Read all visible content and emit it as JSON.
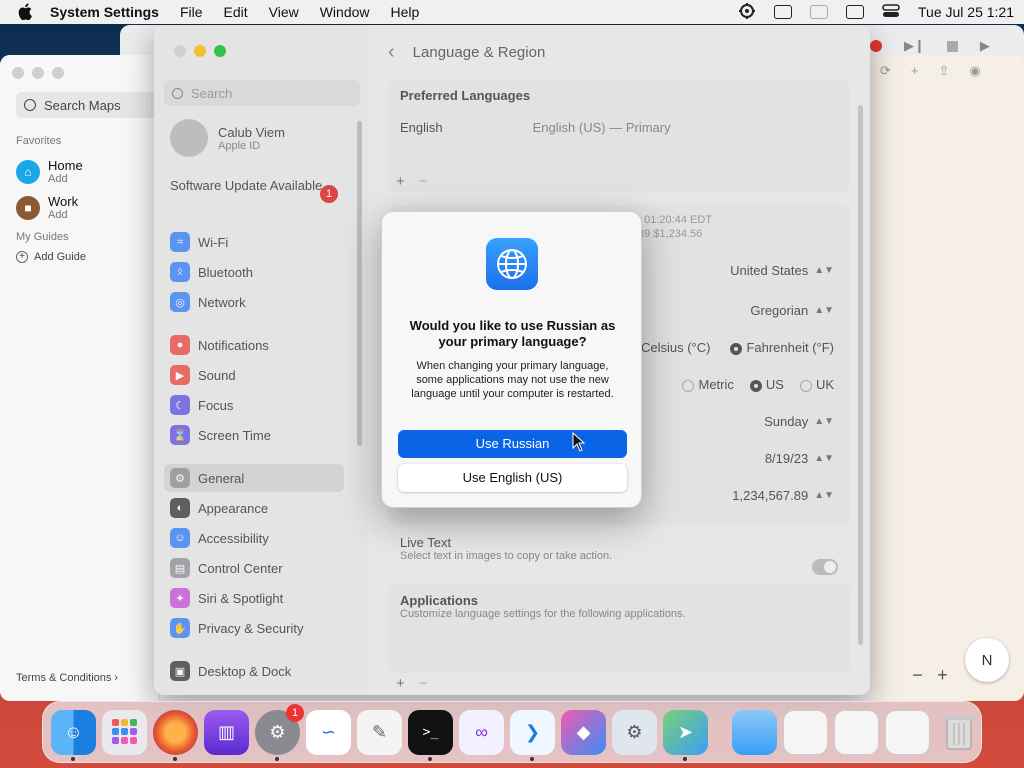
{
  "menubar": {
    "app": "System Settings",
    "items": [
      "File",
      "Edit",
      "View",
      "Window",
      "Help"
    ],
    "clock": "Tue Jul 25  1:21"
  },
  "maps": {
    "search_placeholder": "Search Maps",
    "favorites_label": "Favorites",
    "home": {
      "title": "Home",
      "sub": "Add"
    },
    "work": {
      "title": "Work",
      "sub": "Add"
    },
    "my_guides": "My Guides",
    "add_guide": "Add Guide",
    "terms": "Terms & Conditions",
    "compass": "N",
    "zoom_out": "−",
    "zoom_in": "+"
  },
  "settings": {
    "search_placeholder": "Search",
    "user_name": "Calub Viem",
    "user_sub": "Apple ID",
    "software_update": "Software Update Available",
    "software_update_badge": "1",
    "nav": [
      {
        "label": "Wi-Fi",
        "icon": "wifi-icon",
        "color": "#2f7bf5"
      },
      {
        "label": "Bluetooth",
        "icon": "bluetooth-icon",
        "color": "#2f7bf5"
      },
      {
        "label": "Network",
        "icon": "network-icon",
        "color": "#2f7bf5"
      },
      {
        "label": "Notifications",
        "icon": "bell-icon",
        "color": "#e8453c"
      },
      {
        "label": "Sound",
        "icon": "speaker-icon",
        "color": "#e8453c"
      },
      {
        "label": "Focus",
        "icon": "moon-icon",
        "color": "#5b4ee0"
      },
      {
        "label": "Screen Time",
        "icon": "hourglass-icon",
        "color": "#5b4ee0"
      },
      {
        "label": "General",
        "icon": "gear-icon",
        "color": "#8e8e93"
      },
      {
        "label": "Appearance",
        "icon": "appearance-icon",
        "color": "#333333"
      },
      {
        "label": "Accessibility",
        "icon": "accessibility-icon",
        "color": "#2f7bf5"
      },
      {
        "label": "Control Center",
        "icon": "control-center-icon",
        "color": "#8e8e93"
      },
      {
        "label": "Siri & Spotlight",
        "icon": "siri-icon",
        "color": "#c04cd8"
      },
      {
        "label": "Privacy & Security",
        "icon": "hand-icon",
        "color": "#2f7bf5"
      },
      {
        "label": "Desktop & Dock",
        "icon": "dock-icon",
        "color": "#333333"
      }
    ],
    "header_title": "Language & Region",
    "preferred_languages": "Preferred Languages",
    "lang_name": "English",
    "lang_value": "English (US) — Primary",
    "preview_time": "t 01:20:44 EDT",
    "preview_numbers": "39    $1,234.56",
    "region": "United States",
    "calendar": "Gregorian",
    "temp_celsius": "Celsius (°C)",
    "temp_fahrenheit": "Fahrenheit (°F)",
    "measure_metric": "Metric",
    "measure_us": "US",
    "measure_uk": "UK",
    "first_day": "Sunday",
    "date_format": "8/19/23",
    "number_format": "1,234,567.89",
    "live_text": "Live Text",
    "live_text_desc": "Select text in images to copy or take action.",
    "applications": "Applications",
    "applications_desc": "Customize language settings for the following applications."
  },
  "dialog": {
    "title": "Would you like to use Russian as your primary language?",
    "message": "When changing your primary language, some applications may not use the new language until your computer is restarted.",
    "primary_button": "Use Russian",
    "secondary_button": "Use English (US)"
  },
  "dock": {
    "settings_badge": "1"
  }
}
